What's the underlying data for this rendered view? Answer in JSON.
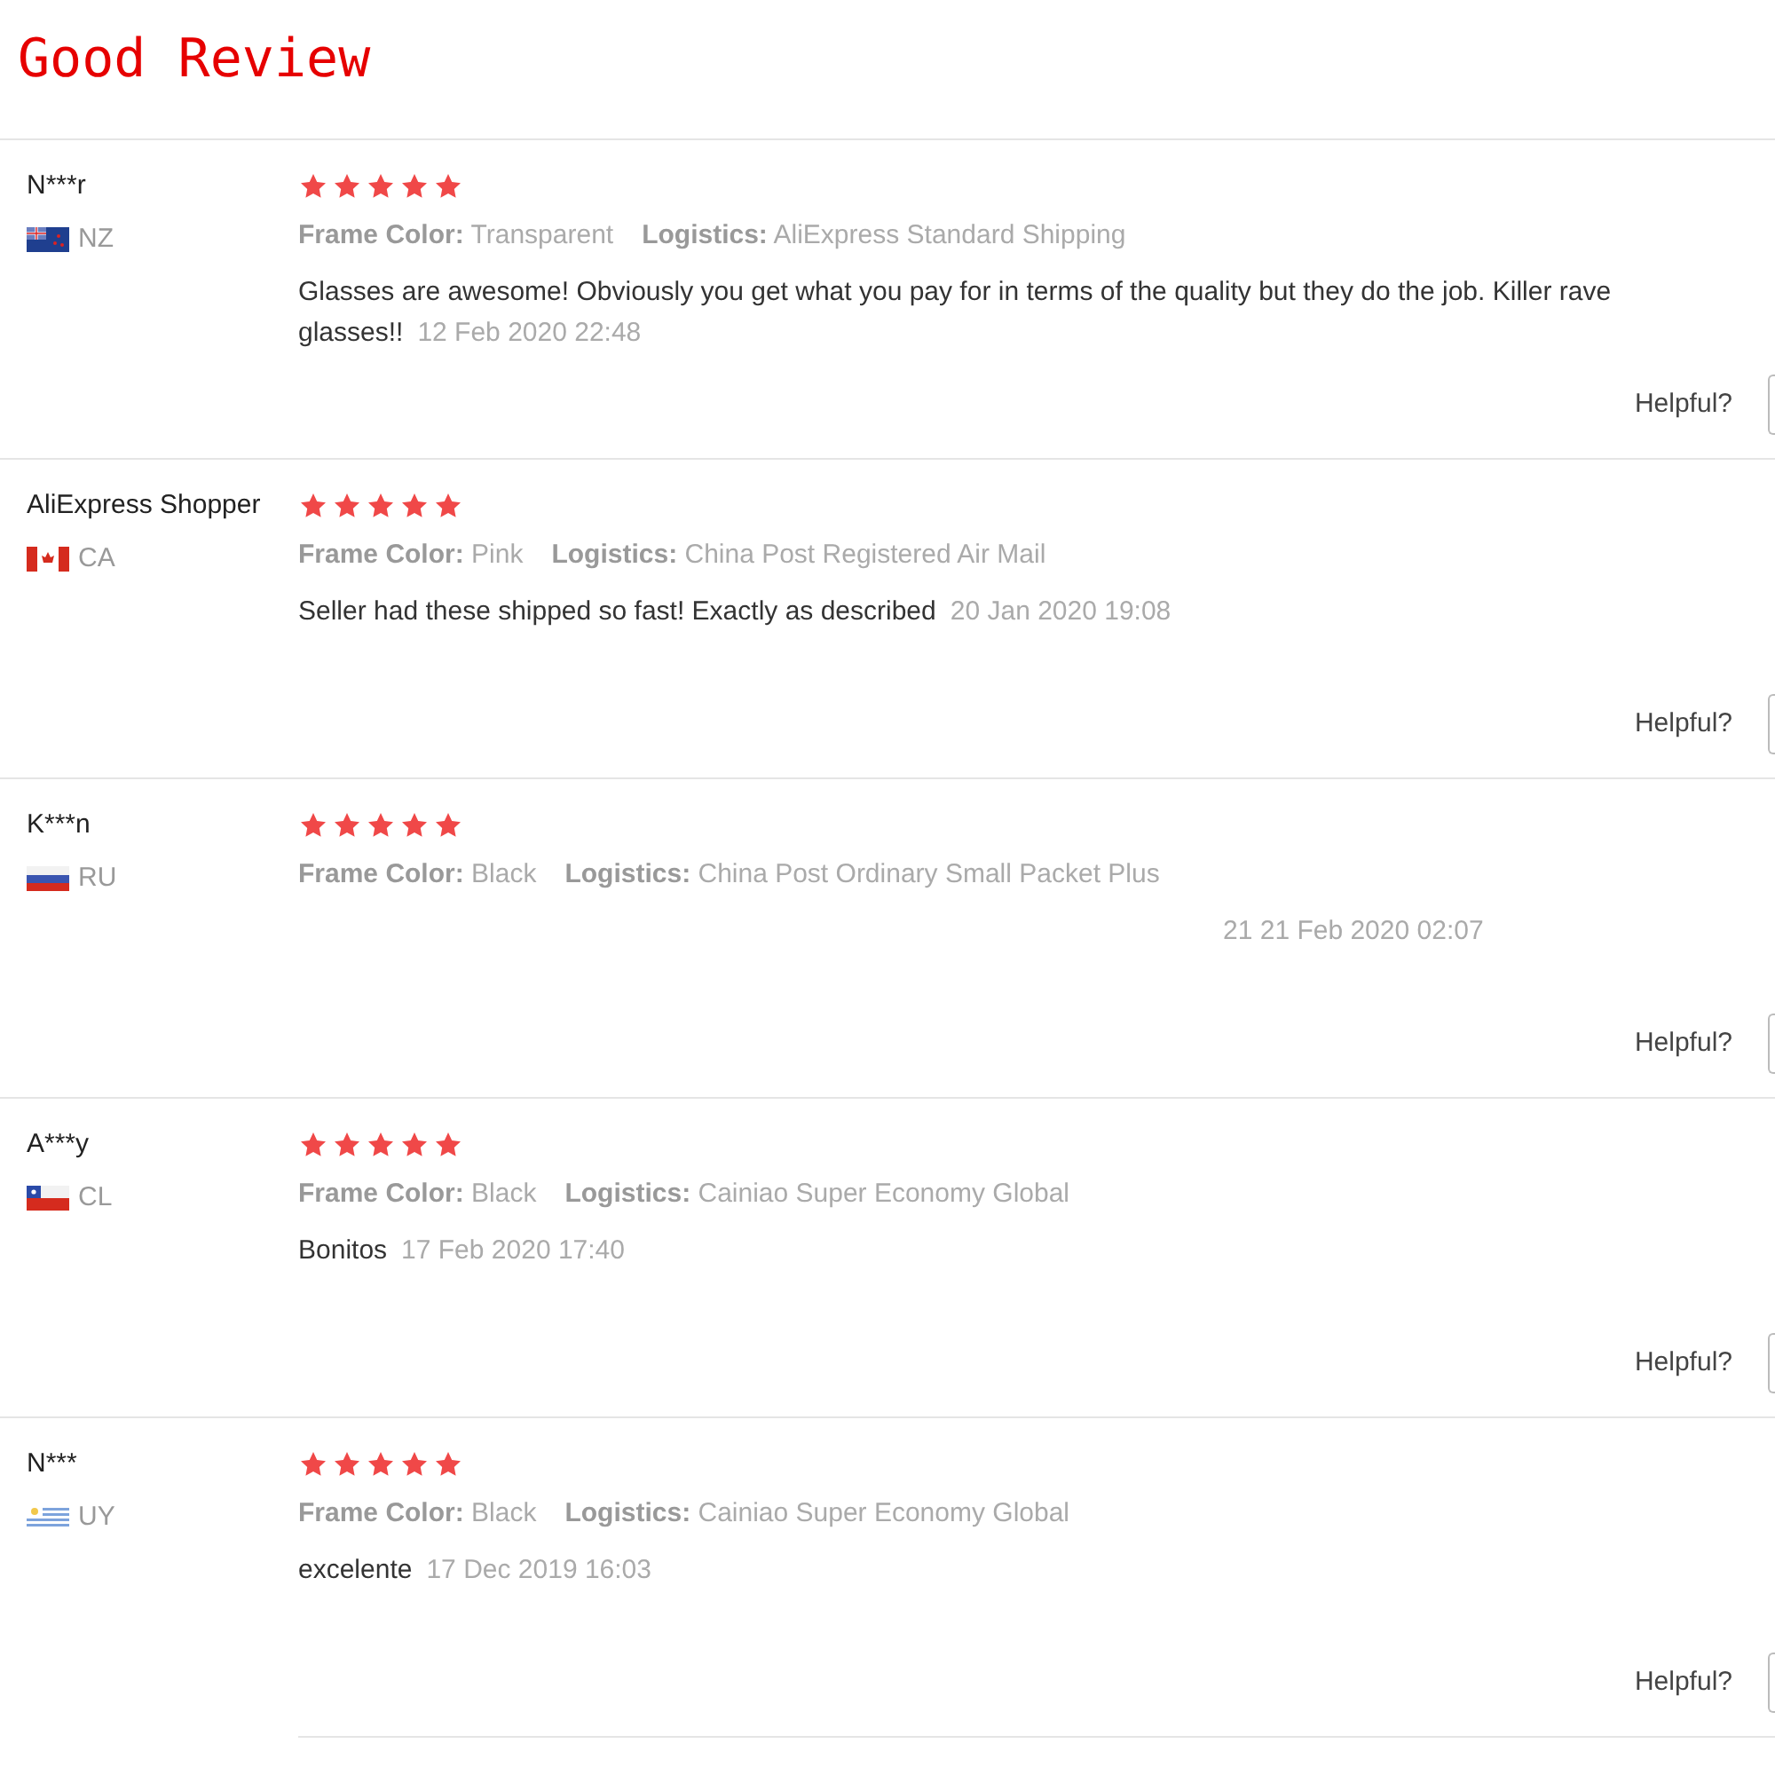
{
  "title": "Good Review",
  "reviews": [
    {
      "name": "N***r",
      "kind": "newzealand",
      "country": "NZ",
      "stars": 5,
      "frame_label": "Frame Color:",
      "frame_color": "Transparent",
      "logistics_label": "Logistics:",
      "logistics": "AliExpress Standard Shipping",
      "comment": "Glasses are awesome! Obviously you get what you pay for in terms of the quality but they do the job. Killer rave glasses!!",
      "date": "12 Feb 2020 22:48",
      "helpful": "Helpful?"
    },
    {
      "name": "AliExpress Shopper",
      "kind": "canada",
      "country": "CA",
      "stars": 5,
      "frame_label": "Frame Color:",
      "frame_color": "Pink",
      "logistics_label": "Logistics:",
      "logistics": "China Post Registered Air Mail",
      "comment": "Seller had these shipped so fast! Exactly as described",
      "date": "20 Jan 2020 19:08",
      "helpful": "Helpful?"
    },
    {
      "name": "K***n",
      "kind": "russia",
      "country": "RU",
      "stars": 5,
      "frame_label": "Frame Color:",
      "frame_color": "Black",
      "logistics_label": "Logistics:",
      "logistics": "China Post Ordinary Small Packet Plus",
      "date": "21 21 Feb 2020 02:07",
      "helpful": "Helpful?"
    },
    {
      "name": "A***y",
      "kind": "chile",
      "country": "CL",
      "stars": 5,
      "frame_label": "Frame Color:",
      "frame_color": "Black",
      "logistics_label": "Logistics:",
      "logistics": "Cainiao Super Economy Global",
      "comment": "Bonitos",
      "date": "17 Feb 2020 17:40",
      "helpful": "Helpful?"
    },
    {
      "name": "N***",
      "kind": "uruguay",
      "country": "UY",
      "stars": 5,
      "frame_label": "Frame Color:",
      "frame_color": "Black",
      "logistics_label": "Logistics:",
      "logistics": "Cainiao Super Economy Global",
      "comment": "excelente",
      "date": "17 Dec 2019 16:03",
      "helpful": "Helpful?"
    }
  ]
}
